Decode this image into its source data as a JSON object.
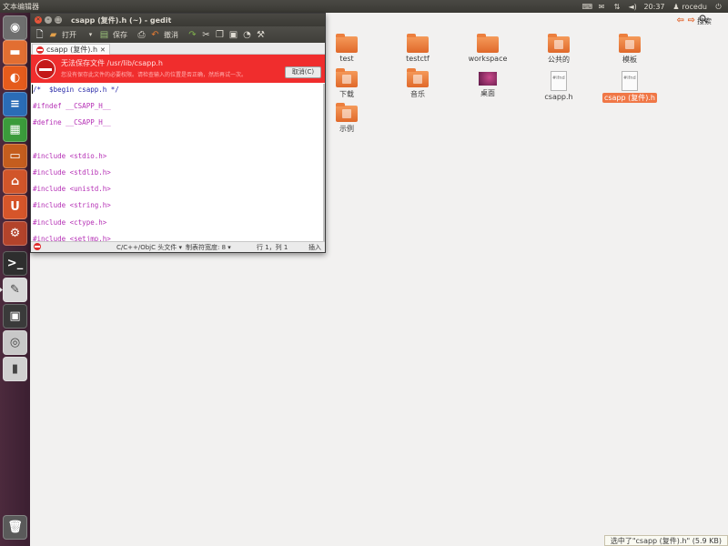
{
  "top_panel": {
    "app_name": "文本编辑器",
    "time": "20:37",
    "user": "rocedu"
  },
  "launcher": {
    "items": [
      {
        "name": "dash-home",
        "glyph": "◉",
        "color": "#6e6e6e"
      },
      {
        "name": "files",
        "glyph": "▬",
        "color": "#e26e32"
      },
      {
        "name": "firefox",
        "glyph": "◐",
        "color": "#e55b1c"
      },
      {
        "name": "writer",
        "glyph": "≡",
        "color": "#2a6cb6"
      },
      {
        "name": "calc",
        "glyph": "▦",
        "color": "#3b9b3b"
      },
      {
        "name": "impress",
        "glyph": "▭",
        "color": "#c45d1e"
      },
      {
        "name": "software-center",
        "glyph": "⌂",
        "color": "#d1552a"
      },
      {
        "name": "ubuntu-one",
        "glyph": "U",
        "color": "#d6552a"
      },
      {
        "name": "system-settings",
        "glyph": "⚙",
        "color": "#b3432b"
      },
      {
        "name": "terminal",
        "glyph": ">_",
        "color": "#2e2e2e"
      },
      {
        "name": "text-editor",
        "glyph": "✎",
        "color": "#d8d8d8"
      },
      {
        "name": "workspace-switcher",
        "glyph": "▣",
        "color": "#3a3a3a"
      },
      {
        "name": "dvd",
        "glyph": "◎",
        "color": "#c8c8c8"
      },
      {
        "name": "usb",
        "glyph": "▮",
        "color": "#d0d0d0"
      },
      {
        "name": "trash",
        "glyph": "🗑",
        "color": "#5a5a5a"
      }
    ]
  },
  "file_manager": {
    "search_label": "搜索",
    "files": [
      {
        "label": "test",
        "kind": "folder",
        "selected": false
      },
      {
        "label": "testctf",
        "kind": "folder",
        "selected": false
      },
      {
        "label": "workspace",
        "kind": "folder",
        "selected": false
      },
      {
        "label": "公共的",
        "kind": "folder-emblem",
        "selected": false
      },
      {
        "label": "模板",
        "kind": "folder-emblem",
        "selected": false
      },
      {
        "label": "下载",
        "kind": "folder-emblem",
        "selected": false
      },
      {
        "label": "音乐",
        "kind": "folder-emblem",
        "selected": false
      },
      {
        "label": "桌面",
        "kind": "picture",
        "selected": false
      },
      {
        "label": "csapp.h",
        "kind": "doc",
        "selected": false
      },
      {
        "label": "csapp (复件).h",
        "kind": "doc",
        "selected": true
      },
      {
        "label": "示例",
        "kind": "folder-emblem",
        "selected": false
      }
    ],
    "doc_icon_text": "#ifnd",
    "status": "选中了\"csapp (复件).h\" (5.9 KB)"
  },
  "gedit": {
    "title": "csapp (复件).h (~) - gedit",
    "toolbar": {
      "open_label": "打开",
      "save_label": "保存",
      "undo_label": "撤消"
    },
    "tab_label": "csapp (复件).h",
    "error": {
      "title": "无法保存文件 /usr/lib/csapp.h",
      "detail": "您没有保存此文件的必要权限。请检查输入的位置是否正确，然后再试一次。",
      "cancel_label": "取消(C)"
    },
    "code_lines": [
      {
        "text": "/*  $begin csapp.h */",
        "style": "comment"
      },
      {
        "text": "#ifndef __CSAPP_H__",
        "style": "preproc"
      },
      {
        "text": "#define __CSAPP_H__",
        "style": "preproc"
      },
      {
        "text": "",
        "style": "plain"
      },
      {
        "text": "#include <stdio.h>",
        "style": "preproc"
      },
      {
        "text": "#include <stdlib.h>",
        "style": "preproc"
      },
      {
        "text": "#include <unistd.h>",
        "style": "preproc"
      },
      {
        "text": "#include <string.h>",
        "style": "preproc"
      },
      {
        "text": "#include <ctype.h>",
        "style": "preproc"
      },
      {
        "text": "#include <setjmp.h>",
        "style": "preproc"
      }
    ],
    "status": {
      "language": "C/C++/ObjC 头文件 ▾",
      "tab_width": "制表符宽度: 8 ▾",
      "position": "行 1，列 1",
      "mode": "插入"
    }
  }
}
